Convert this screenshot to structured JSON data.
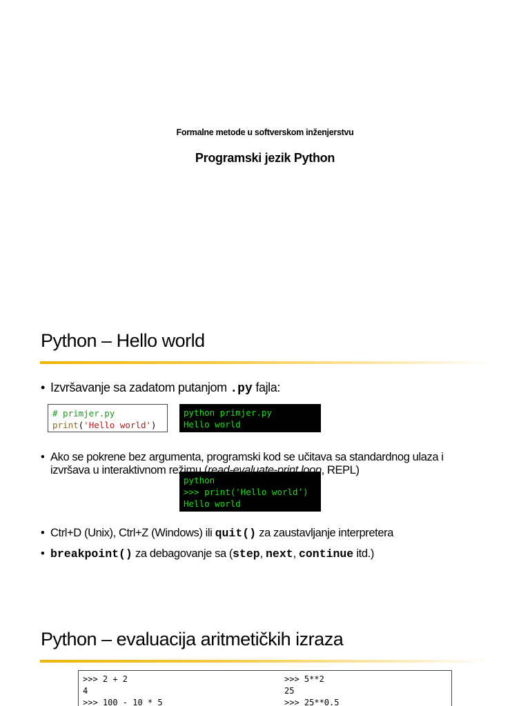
{
  "slide1": {
    "subtitle": "Formalne metode u softverskom inženjerstvu",
    "title": "Programski jezik Python"
  },
  "slide2": {
    "title": "Python – Hello world",
    "bullet1": {
      "pre": "Izvršavanje sa zadatom putanjom ",
      "code": ".py",
      "post": " fajla:"
    },
    "file_code": {
      "comment": "# primjer.py",
      "fn": "print",
      "open": "(",
      "str": "'Hello world'",
      "close": ")"
    },
    "terminal1": [
      "python primjer.py",
      "Hello world"
    ],
    "bullet2": {
      "line1": "Ako se pokrene bez argumenta, programski kod se učitava sa standardnog ulaza i",
      "line2_pre": "izvršava u interaktivnom režimu (",
      "line2_em": "read-evaluate-print loop",
      "line2_post": ", REPL)"
    },
    "terminal2": [
      "python",
      ">>> print('Hello world’)",
      "Hello world"
    ],
    "bullet3": {
      "pre": "Ctrl+D (Unix), Ctrl+Z (Windows) ili ",
      "code": "quit()",
      "post": " za zaustavljanje interpretera"
    },
    "bullet4": {
      "code1": "breakpoint()",
      "t1": " za debagovanje sa (",
      "c2": "step",
      "t2": ", ",
      "c3": "next",
      "t3": ", ",
      "c4": "continue",
      "t4": " itd.)"
    }
  },
  "slide3": {
    "title": "Python – evaluacija aritmetičkih izraza",
    "left": [
      ">>> 2 + 2",
      "4",
      ">>> 100 - 10 * 5"
    ],
    "right": [
      ">>> 5**2",
      "25",
      ">>> 25**0.5"
    ]
  }
}
